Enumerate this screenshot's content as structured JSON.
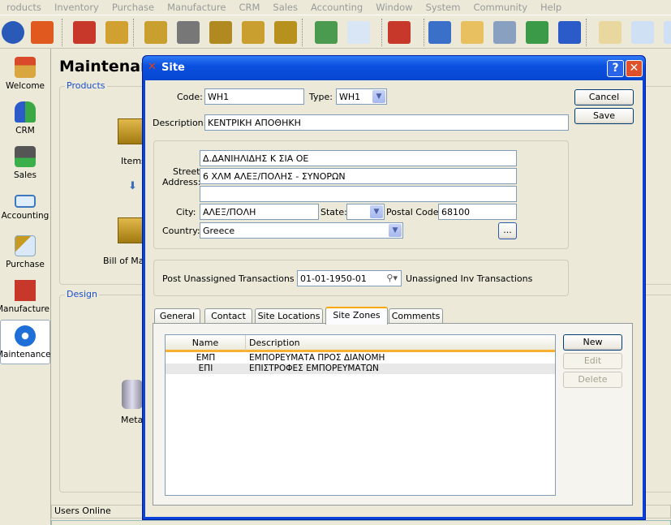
{
  "menu": [
    "roducts",
    "Inventory",
    "Purchase",
    "Manufacture",
    "CRM",
    "Sales",
    "Accounting",
    "Window",
    "System",
    "Community",
    "Help"
  ],
  "toolbar_icons": [
    "globe-icon",
    "xtuple-clock-icon",
    "items-icon",
    "item-list-icon",
    "checked-document-icon",
    "shipping-icon",
    "search-items-icon",
    "inventory-icon",
    "item-lookup-icon",
    "document-refresh-icon",
    "document-icon",
    "factory-clock-icon",
    "user-chat-icon",
    "clipboard-icon",
    "spreadsheet-icon",
    "users-group-icon",
    "users-icon",
    "clipboard-list-icon",
    "document-check-icon",
    "document-icon"
  ],
  "sidebar": {
    "items": [
      {
        "label": "Welcome",
        "icon": "house-icon"
      },
      {
        "label": "CRM",
        "icon": "users-icon"
      },
      {
        "label": "Sales",
        "icon": "money-icon"
      },
      {
        "label": "Accounting",
        "icon": "book-icon"
      },
      {
        "label": "Purchase",
        "icon": "purchase-document-icon"
      },
      {
        "label": "Manufacture",
        "icon": "factory-icon"
      },
      {
        "label": "Maintenance",
        "icon": "gear-icon",
        "active": true
      }
    ]
  },
  "main": {
    "title": "Maintenance",
    "products_group": "Products",
    "design_group": "Design",
    "items_label": "Items",
    "bom_label": "Bill of Mat",
    "meta_label": "Meta",
    "users_online": "Users Online"
  },
  "dialog": {
    "title": "Site",
    "code_label": "Code:",
    "code": "WH1",
    "type_label": "Type:",
    "type": "WH1",
    "description_label": "Description:",
    "description": "ΚΕΝΤΡΙΚΗ ΑΠΟΘΗΚΗ",
    "street_label_1": "Street",
    "street_label_2": "Address:",
    "street": [
      "Δ.ΔΑΝΙΗΛΙΔΗΣ Κ ΣΙΑ ΟΕ",
      "6 ΧΛΜ ΑΛΕΞ/ΠΟΛΗΣ - ΣΥΝΟΡΩΝ",
      ""
    ],
    "city_label": "City:",
    "city": "ΑΛΕΞ/ΠΟΛΗ",
    "state_label": "State:",
    "state": "",
    "postal_label": "Postal Code:",
    "postal": "68100",
    "country_label": "Country:",
    "country": "Greece",
    "more_button": "...",
    "cancel": "Cancel",
    "save": "Save",
    "post_label": "Post Unassigned Transactions to:",
    "post_account": "01-01-1950-01",
    "post_account_desc": "Unassigned Inv Transactions",
    "tabs": [
      "General",
      "Contact",
      "Site Locations",
      "Site Zones",
      "Comments"
    ],
    "active_tab": "Site Zones",
    "zones": {
      "columns": [
        "Name",
        "Description"
      ],
      "rows": [
        [
          "ΕΜΠ",
          "ΕΜΠΟΡΕΥΜΑΤΑ ΠΡΟΣ ΔΙΑΝΟΜΗ"
        ],
        [
          "ΕΠΙ",
          "ΕΠΙΣΤΡΟΦΕΣ ΕΜΠΟΡΕΥΜΑΤΩΝ"
        ]
      ]
    },
    "new": "New",
    "edit": "Edit",
    "delete": "Delete"
  }
}
